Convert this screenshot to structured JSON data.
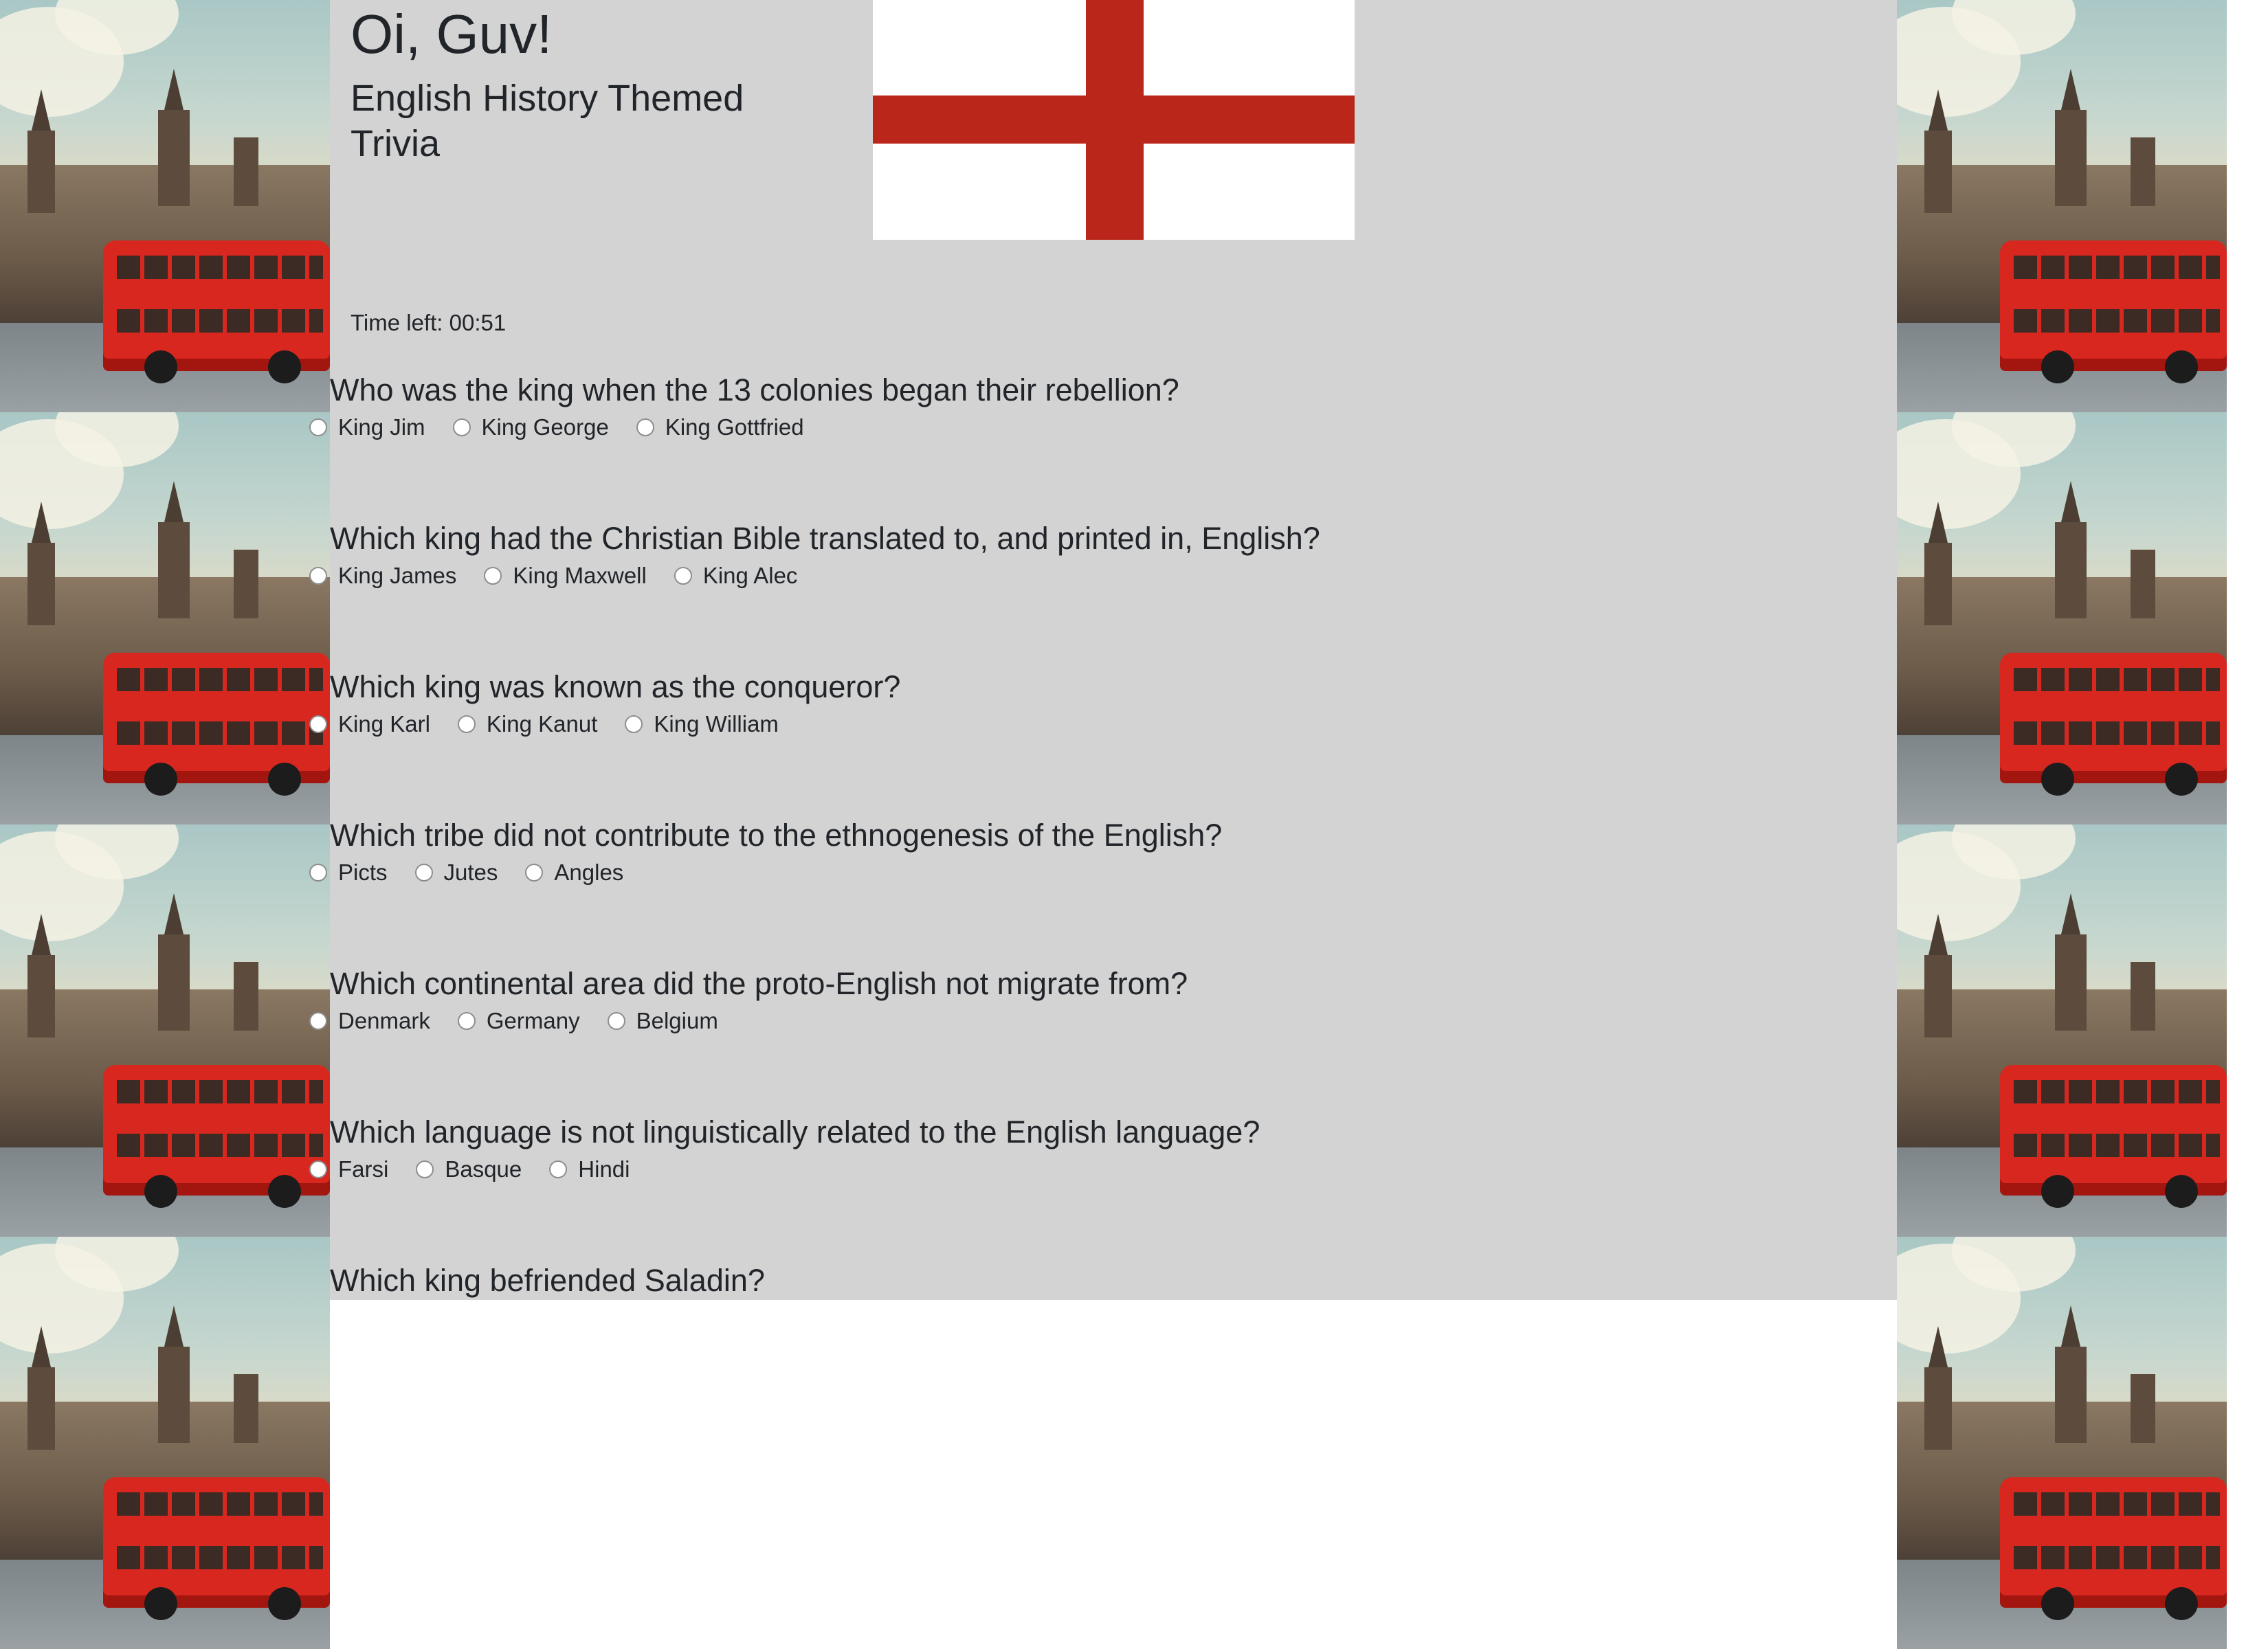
{
  "header": {
    "title": "Oi, Guv!",
    "subtitle": "English History Themed Trivia"
  },
  "flag_icon": "st-george-cross-flag",
  "colors": {
    "panel_background": "#d3d3d3",
    "flag_red": "#bb261a",
    "text": "#212529"
  },
  "timer": {
    "text": "Time left: 00:51"
  },
  "questions": [
    {
      "text": "Who was the king when the 13 colonies began their rebellion?",
      "options": [
        "King Jim",
        "King George",
        "King Gottfried"
      ]
    },
    {
      "text": "Which king had the Christian Bible translated to, and printed in, English?",
      "options": [
        "King James",
        "King Maxwell",
        "King Alec"
      ]
    },
    {
      "text": "Which king was known as the conqueror?",
      "options": [
        "King Karl",
        "King Kanut",
        "King William"
      ]
    },
    {
      "text": "Which tribe did not contribute to the ethnogenesis of the English?",
      "options": [
        "Picts",
        "Jutes",
        "Angles"
      ]
    },
    {
      "text": "Which continental area did the proto-English not migrate from?",
      "options": [
        "Denmark",
        "Germany",
        "Belgium"
      ]
    },
    {
      "text": "Which language is not linguistically related to the English language?",
      "options": [
        "Farsi",
        "Basque",
        "Hindi"
      ]
    },
    {
      "text": "Which king befriended Saladin?",
      "options": []
    }
  ]
}
